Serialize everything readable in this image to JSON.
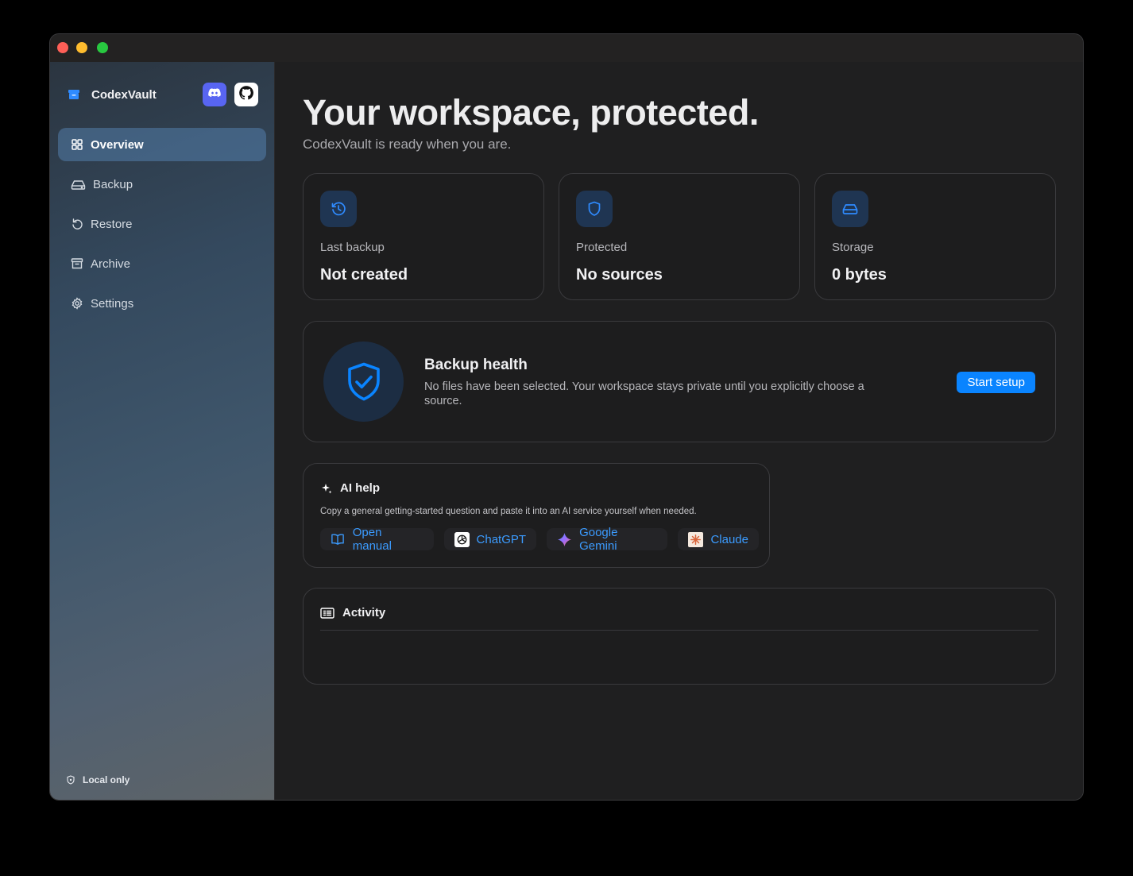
{
  "app": {
    "name": "CodexVault"
  },
  "sidebar": {
    "social": [
      "discord",
      "github"
    ],
    "items": [
      {
        "label": "Overview",
        "icon": "grid-icon",
        "active": true
      },
      {
        "label": "Backup",
        "icon": "drive-icon"
      },
      {
        "label": "Restore",
        "icon": "restore-icon"
      },
      {
        "label": "Archive",
        "icon": "archive-icon"
      },
      {
        "label": "Settings",
        "icon": "gear-icon"
      }
    ],
    "footer": "Local only"
  },
  "hero": {
    "title": "Your workspace, protected.",
    "subtitle": "CodexVault is ready when you are."
  },
  "stats": [
    {
      "label": "Last backup",
      "value": "Not created",
      "icon": "history-icon"
    },
    {
      "label": "Protected",
      "value": "No sources",
      "icon": "shield-icon"
    },
    {
      "label": "Storage",
      "value": "0 bytes",
      "icon": "drive-icon"
    }
  ],
  "health": {
    "title": "Backup health",
    "text": "No files have been selected. Your workspace stays private until you explicitly choose a source.",
    "button": "Start setup"
  },
  "ai_help": {
    "title": "AI help",
    "description": "Copy a general getting-started question and paste it into an AI service yourself when needed.",
    "links": [
      {
        "label": "Open manual",
        "icon": "book-icon"
      },
      {
        "label": "ChatGPT",
        "icon": "chatgpt-icon"
      },
      {
        "label": "Google Gemini",
        "icon": "gemini-icon"
      },
      {
        "label": "Claude",
        "icon": "claude-icon"
      }
    ]
  },
  "activity": {
    "title": "Activity"
  },
  "colors": {
    "accent": "#0a84ff",
    "background": "#1f1f20",
    "card_border": "#3a3a3d"
  }
}
